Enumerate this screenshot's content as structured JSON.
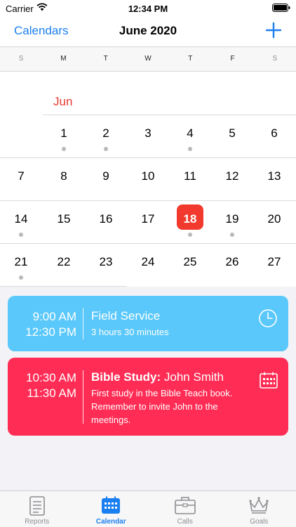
{
  "status_bar": {
    "carrier": "Carrier",
    "time": "12:34 PM"
  },
  "nav": {
    "back_label": "Calendars",
    "title": "June 2020"
  },
  "weekdays": [
    "S",
    "M",
    "T",
    "W",
    "T",
    "F",
    "S"
  ],
  "calendar": {
    "month_label": "Jun",
    "today_color": "#f13a2d",
    "weeks": [
      [
        null,
        {
          "d": "1",
          "dot": true
        },
        {
          "d": "2",
          "dot": true
        },
        {
          "d": "3",
          "dot": false
        },
        {
          "d": "4",
          "dot": true
        },
        {
          "d": "5",
          "dot": false
        },
        {
          "d": "6",
          "dot": false
        }
      ],
      [
        {
          "d": "7",
          "dot": false
        },
        {
          "d": "8",
          "dot": false
        },
        {
          "d": "9",
          "dot": false
        },
        {
          "d": "10",
          "dot": false
        },
        {
          "d": "11",
          "dot": false
        },
        {
          "d": "12",
          "dot": false
        },
        {
          "d": "13",
          "dot": false
        }
      ],
      [
        {
          "d": "14",
          "dot": true
        },
        {
          "d": "15",
          "dot": false
        },
        {
          "d": "16",
          "dot": false
        },
        {
          "d": "17",
          "dot": false
        },
        {
          "d": "18",
          "dot": true,
          "today": true
        },
        {
          "d": "19",
          "dot": true
        },
        {
          "d": "20",
          "dot": false
        }
      ],
      [
        {
          "d": "21",
          "dot": true
        },
        {
          "d": "22",
          "dot": false
        },
        {
          "d": "23",
          "dot": false
        },
        {
          "d": "24",
          "dot": false
        },
        {
          "d": "25",
          "dot": false
        },
        {
          "d": "26",
          "dot": false
        },
        {
          "d": "27",
          "dot": false
        }
      ]
    ]
  },
  "events": [
    {
      "color": "#5ac8fa",
      "start": "9:00 AM",
      "end": "12:30 PM",
      "title_bold": "",
      "title": "Field Service",
      "subtitle": "3 hours 30 minutes",
      "icon": "clock-icon"
    },
    {
      "color": "#ff2d55",
      "start": "10:30 AM",
      "end": "11:30 AM",
      "title_bold": "Bible Study:",
      "title": " John Smith",
      "subtitle": "First study in the Bible Teach book. Remember to invite John to the meetings.",
      "icon": "calendar-grid-icon"
    }
  ],
  "tabs": [
    {
      "label": "Reports",
      "icon": "document-icon",
      "active": false
    },
    {
      "label": "Calendar",
      "icon": "calendar-icon",
      "active": true
    },
    {
      "label": "Calls",
      "icon": "briefcase-icon",
      "active": false
    },
    {
      "label": "Goals",
      "icon": "crown-icon",
      "active": false
    }
  ],
  "colors": {
    "accent": "#1a7ff0",
    "today": "#f13a2d",
    "inactive": "#8e8e93"
  }
}
